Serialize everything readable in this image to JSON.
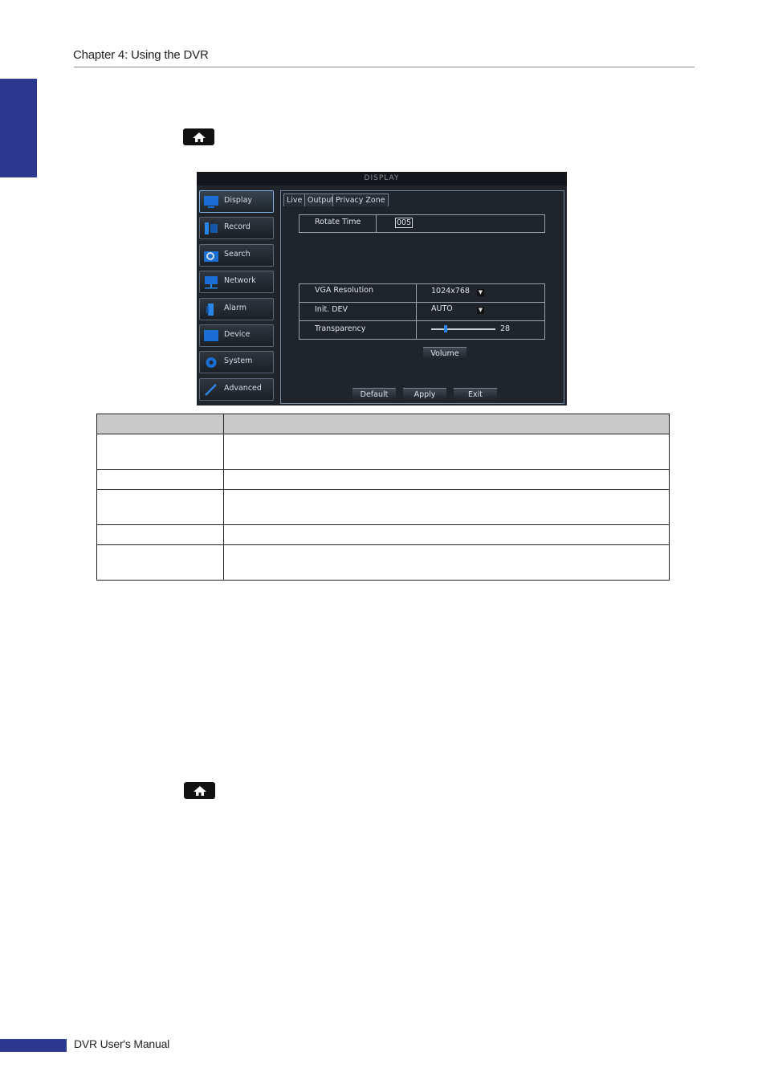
{
  "header": {
    "chapter_title": "Chapter 4: Using the DVR"
  },
  "footer": {
    "manual_title": "DVR User's Manual"
  },
  "icons": {
    "home_button_1": "home-icon",
    "home_button_2": "home-icon"
  },
  "dvr": {
    "title": "DISPLAY",
    "menu": [
      {
        "label": "Display",
        "icon": "display-icon"
      },
      {
        "label": "Record",
        "icon": "record-icon"
      },
      {
        "label": "Search",
        "icon": "search-icon"
      },
      {
        "label": "Network",
        "icon": "network-icon"
      },
      {
        "label": "Alarm",
        "icon": "alarm-icon"
      },
      {
        "label": "Device",
        "icon": "device-icon"
      },
      {
        "label": "System",
        "icon": "gear-icon"
      },
      {
        "label": "Advanced",
        "icon": "wrench-icon"
      }
    ],
    "tabs": [
      "Live",
      "Output",
      "Privacy Zone"
    ],
    "active_tab": "Output",
    "rotate_time": {
      "label": "Rotate Time",
      "value": "005"
    },
    "vga_resolution": {
      "label": "VGA Resolution",
      "value": "1024x768"
    },
    "init_dev": {
      "label": "Init. DEV",
      "value": "AUTO"
    },
    "transparency": {
      "label": "Transparency",
      "value": 28,
      "value_text": "28"
    },
    "buttons": {
      "volume": "Volume",
      "default": "Default",
      "apply": "Apply",
      "exit": "Exit"
    }
  },
  "table": {
    "header": [
      "",
      ""
    ],
    "rows": [
      [
        "",
        ""
      ],
      [
        "",
        ""
      ],
      [
        "",
        ""
      ],
      [
        "",
        ""
      ],
      [
        "",
        ""
      ]
    ]
  }
}
